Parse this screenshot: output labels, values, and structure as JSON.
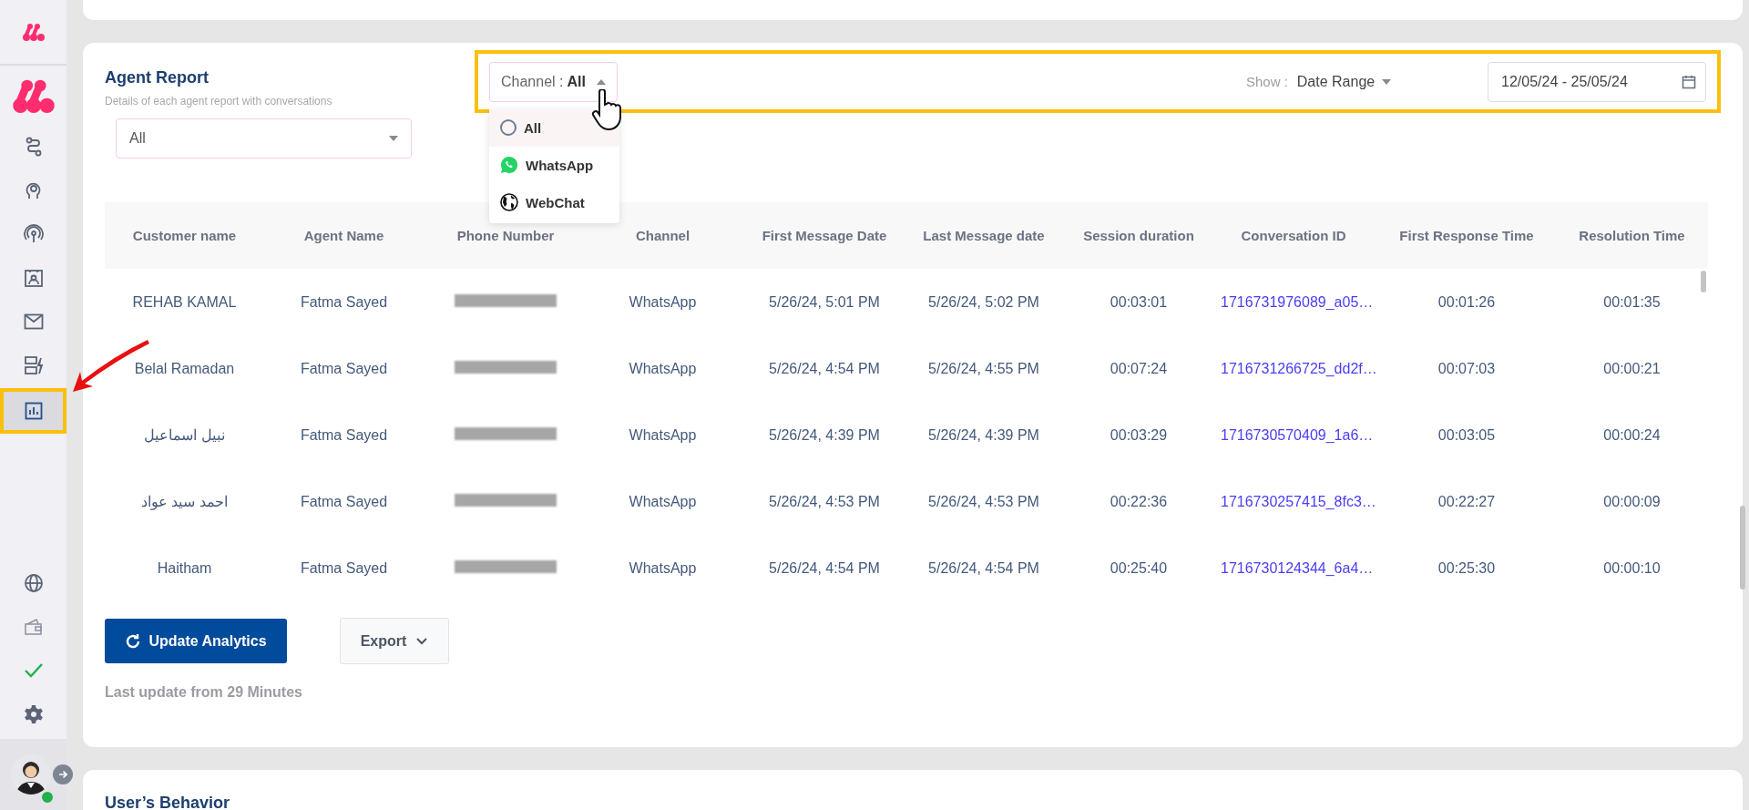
{
  "sidebar": {
    "items": [
      {
        "kind": "route",
        "selected": false
      },
      {
        "kind": "brain",
        "selected": false
      },
      {
        "kind": "broadcast",
        "selected": false
      },
      {
        "kind": "contact",
        "selected": false
      },
      {
        "kind": "mail",
        "selected": false
      },
      {
        "kind": "automation",
        "selected": false
      },
      {
        "kind": "chart",
        "selected": true
      }
    ],
    "bottom_items": [
      {
        "kind": "globe"
      },
      {
        "kind": "wallet"
      },
      {
        "kind": "check"
      },
      {
        "kind": "gear"
      }
    ],
    "user": {
      "online": true
    }
  },
  "report": {
    "title": "Agent Report",
    "subtitle": "Details of each agent report with conversations",
    "agent_select": {
      "value": "All"
    },
    "channel_filter": {
      "label": "Channel :",
      "value": "All",
      "expanded": true,
      "options": [
        {
          "label": "All",
          "kind": "radio",
          "selected": true
        },
        {
          "label": "WhatsApp",
          "kind": "whatsapp",
          "selected": false
        },
        {
          "label": "WebChat",
          "kind": "globe",
          "selected": false
        }
      ]
    },
    "show": {
      "label": "Show :",
      "value": "Date Range"
    },
    "date_range": {
      "value": "12/05/24 - 25/05/24"
    },
    "table": {
      "columns": [
        "Customer name",
        "Agent Name",
        "Phone Number",
        "Channel",
        "First Message Date",
        "Last Message date",
        "Session duration",
        "Conversation ID",
        "First Response Time",
        "Resolution Time"
      ],
      "rows": [
        {
          "customer": "REHAB KAMAL",
          "agent": "Fatma Sayed",
          "channel": "WhatsApp",
          "first": "5/26/24, 5:01 PM",
          "last": "5/26/24, 5:02 PM",
          "session": "00:03:01",
          "conversation_id": "1716731976089_a05…",
          "first_response": "00:01:26",
          "resolution": "00:01:35"
        },
        {
          "customer": "Belal Ramadan",
          "agent": "Fatma Sayed",
          "channel": "WhatsApp",
          "first": "5/26/24, 4:54 PM",
          "last": "5/26/24, 4:55 PM",
          "session": "00:07:24",
          "conversation_id": "1716731266725_dd2f…",
          "first_response": "00:07:03",
          "resolution": "00:00:21"
        },
        {
          "customer": "نبيل اسماعيل",
          "agent": "Fatma Sayed",
          "channel": "WhatsApp",
          "first": "5/26/24, 4:39 PM",
          "last": "5/26/24, 4:39 PM",
          "session": "00:03:29",
          "conversation_id": "1716730570409_1a6…",
          "first_response": "00:03:05",
          "resolution": "00:00:24"
        },
        {
          "customer": "احمد سيد عواد",
          "agent": "Fatma Sayed",
          "channel": "WhatsApp",
          "first": "5/26/24, 4:53 PM",
          "last": "5/26/24, 4:53 PM",
          "session": "00:22:36",
          "conversation_id": "1716730257415_8fc3…",
          "first_response": "00:22:27",
          "resolution": "00:00:09"
        },
        {
          "customer": "Haitham",
          "agent": "Fatma Sayed",
          "channel": "WhatsApp",
          "first": "5/26/24, 4:54 PM",
          "last": "5/26/24, 4:54 PM",
          "session": "00:25:40",
          "conversation_id": "1716730124344_6a4…",
          "first_response": "00:25:30",
          "resolution": "00:00:10"
        }
      ]
    },
    "update_button": "Update Analytics",
    "export_button": "Export",
    "last_update": "Last update from 29 Minutes"
  },
  "next_section": {
    "title": "User’s Behavior"
  }
}
